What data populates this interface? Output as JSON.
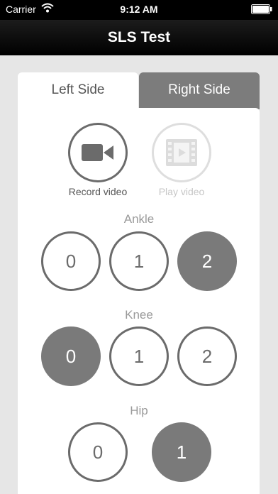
{
  "status_bar": {
    "carrier": "Carrier",
    "time": "9:12 AM"
  },
  "nav": {
    "title": "SLS Test"
  },
  "tabs": {
    "left": "Left Side",
    "right": "Right Side",
    "active": "left"
  },
  "media": {
    "record_label": "Record video",
    "play_label": "Play video"
  },
  "sections": {
    "ankle": {
      "label": "Ankle",
      "options": [
        "0",
        "1",
        "2"
      ],
      "selected": "2"
    },
    "knee": {
      "label": "Knee",
      "options": [
        "0",
        "1",
        "2"
      ],
      "selected": "0"
    },
    "hip": {
      "label": "Hip",
      "options": [
        "0",
        "1"
      ],
      "selected": "1"
    }
  },
  "colors": {
    "selected_fill": "#7a7a7a",
    "outline": "#6b6b6b",
    "inactive_tab": "#7c7c7c",
    "disabled": "#dedede"
  },
  "icons": {
    "record": "video-camera-icon",
    "play": "film-play-icon",
    "wifi": "wifi-icon",
    "battery": "battery-icon"
  }
}
